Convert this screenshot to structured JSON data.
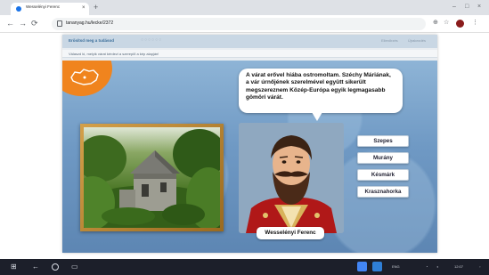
{
  "browser": {
    "tab_title": "Wesselényi Ferenc",
    "url": "tananyag.hu/lecke/2372",
    "tab_close": "×",
    "new_tab": "+",
    "window_controls": [
      "–",
      "□",
      "×"
    ],
    "nav": [
      "←",
      "→",
      "⟳"
    ]
  },
  "app": {
    "title": "Erősítsd meg a tudásod",
    "progress_dots": "○○○○○○",
    "header_links": [
      "Ellenőrzés",
      "Újrakezdés"
    ],
    "instruction": "Válaszd ki, melyik várat kérdezi a szereplő a kép alapján!"
  },
  "scene": {
    "speech": "A várat erővel hiába ostromoltam. Széchy Máriának, a vár úrnőjének szerelmével együtt sikerült megszereznem Közép-Európa egyik legmagasabb gömöri várát.",
    "character_name": "Wesselényi Ferenc",
    "options": [
      "Szepes",
      "Murány",
      "Késmárk",
      "Krasznahorka"
    ]
  },
  "taskbar": {
    "start": "⊞",
    "tray_text": "ENG",
    "clock": "12:07"
  },
  "colors": {
    "accent": "#f0841e",
    "scene_bg": "#6f99c4",
    "frame": "#c58f35"
  }
}
